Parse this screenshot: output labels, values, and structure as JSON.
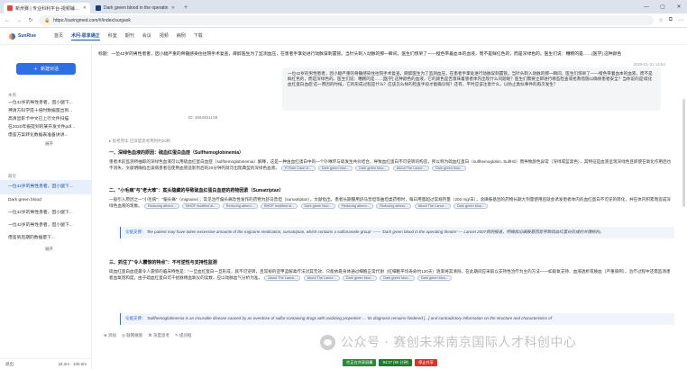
{
  "browser": {
    "tabs": [
      {
        "label": "新卅赛 | 专业科利平台-视频辅导...",
        "fav_color": "#e0443a",
        "active": true
      },
      {
        "label": "Dark green blood in the operatin",
        "fav_color": "#1a3d7c",
        "active": false
      }
    ],
    "url": "https://suringmed.com/#/index/surgask",
    "win_controls": [
      "—",
      "▢",
      "✕"
    ]
  },
  "app": {
    "logo_text": "SunRise",
    "nav": [
      "首页",
      "术问-思享通正",
      "科室",
      "期刊",
      "会议",
      "视频",
      "病例",
      "下载"
    ],
    "nav_active_index": 1
  },
  "sidebar": {
    "new_chat_label": "新建对话",
    "sections": [
      {
        "head": "本周",
        "items": [
          "一位42岁的男性患者，因小腿下...",
          "神清方科学提十倍时数据量出到...",
          "高清显影卡中文已上行文件扫描",
          "在2020年报提到的某开发文件pdf...",
          "借鉴方案转化数据表准备讲讲..."
        ],
        "more": "展开"
      },
      {
        "head": "最近",
        "items": [
          "一位42岁的男性患者，因小腿下...",
          "Dark green blood",
          "一位42岁的男性患者，因小腿下...",
          "一位42岁的男性患者，因小腿下...",
          "借鉴到后期的数据量下..."
        ],
        "more": "展开",
        "selected_index": 0
      }
    ],
    "footer_left": "退出",
    "footer_right": "32.2m · 100.0m"
  },
  "conversation": {
    "prompt": "标题：一位42岁的男性患者，因小腿严重的骨髓感染住往院手术复查，麻醉医生为了监测血压，在患者手掌处进行动脉穿刺置管。当针头刺入动脉的那一瞬间，医生们惊呆了——橙色带着血本的血液，而不是鲜红色的，而是深绿色的。医生们说：糟糕的是……[医学] 这种颜色",
    "timestamp": "2026-01-31 14:54",
    "user_text": "一位42岁的男性患者，因小腿严重的骨髓感染住往院手术复查，麻醉医生为了监测血压，在患者手掌处进行动脉穿刺置管。当针头刺入动脉的那一瞬间，医生们惊呆了——橙色带着血本的血液，而不是鲜红色的，而是深绿色的。医生们说：糟糕的是……[医学] 这种颜色的血液，它的颜色是否意味着患者体内出现什么问题呢？医生们需要立即进行哪些检查或抢救措施以确保患者安全？当你说的是'硫化血红蛋白血症'这一原因的时候，它的形成过程是什么？应该怎么样的检查手段才能确诊呢？还有，平时应该注意什么，以防止类似事件的再次发生？",
    "id_line": "ID: 46634511X8",
    "hint": "▸ 思考完毕 已深度思考用时约20秒",
    "sections": [
      {
        "title": "一、深绿色血液的原因：硫血红蛋白血症（Sulfhemoglobinemia）",
        "body": "患者术前监测所抽取的深绿色血液可以用硫血红蛋白血症（sulfhemoglobinemia）解释，这是一种由血红蛋白中的一个卟啉环与硫发生共价结合，导致血红蛋白不可逆转的构造，所以称为硫血红蛋白（sulfhemoglobin, SulfHb）而导致颜色异常（深绿或蓝黑色），其特征是血液呈现深绿色且即使在氧化作用后也不消失，文献明确指出该病患者在使用血管造影剂后的20分钟内就可出现典型的深绿色血液。",
        "chips": [
          "R Rare Case of...",
          "Dark green bloo...",
          "Dark green bloo...",
          "About The Lance...",
          "Dark green bloo..."
        ]
      },
      {
        "title": "二、\"小毛病\"与\"老大难\"：案头隐藏的导致硫血红蛋白血症的药物因素（Sumatriptan）",
        "body": "一般引入原因之一\"小毛病\"：\"偏头痛\"（migraine）；常见治疗偏头痛急性发作的药物为舒马普坦（sumatriptan）。文献指出，患者长期服用舒马普坦等曲坦类药物时，每日用量超过常规剂量（200 mg/日），含磺胺基团的药物长期大剂量使用后就会诱发患者体内的血红蛋白不可逆的转化，并在体内积累而造成深绿色血液的现象。",
        "chips": [
          "Reducing athero...",
          "BHOF modified st...",
          "Reducing athero...",
          "BHOF modified st...",
          "Dark green bloo...",
          "Reducing athero...",
          "Reducing athero...",
          "About The Lance...",
          "Dark green bloo..."
        ],
        "quote_label": "论据支撑：",
        "quote": "'the patient may have taken excessive amounts of the migraine medication, sumatriptan, which contains a sulfonamide group' —— 'Dark green blood in the operating theatre' — Lancet 2007病例报道，明确指出磺胺基团是导致硫血红蛋白形成的关键结构。"
      },
      {
        "title": "三、抓住了\"令人震惊的特点\"：不可逆性与支持性监测",
        "body": "硫血红蛋白血症最令人震惊的临床特性是：\"一旦血红蛋白一旦形成，就不可逆转，且常规的亚甲蓝解毒疗法对其无效，只能依靠身体通过细胞正常代谢（红细胞平均寿命约120天）逐渐将其清除，在此期间应采取以支持性治疗为主的方法——如吸氧支持、血液透析或换血（严重病例）。治疗过程中还需监测患者血氧饱和度，由于硫血红蛋白可干扰脉搏血氧仪的读数，应以动脉血气分析为准。",
        "chips": [
          "About The Lance...",
          "About The Lance...",
          "Dark green bloo...",
          "Dark green bloo...",
          "Dark green bloo..."
        ],
        "quote_label": "论据支撑：",
        "quote": "'Sulfhemoglobinemia is an incurable disease caused by an overdose of sulfur-containing drugs with oxidizing properties' ... 'its diagnosis remains hindered [...] and contradictory information on the structure and characteristics of"
      }
    ]
  },
  "bottombar": [
    "⊕ 添加",
    "◎ 联网搜索",
    "⌘ 深度思考",
    "✎ 提问框"
  ],
  "footer_tags": [
    {
      "label": "作正在共享屏幕",
      "color": "#2a8a3a"
    },
    {
      "label": "94:37 (90 分钟)",
      "color": "#1f7a2e"
    },
    {
      "label": "停止共享",
      "color": "#d9342b"
    }
  ],
  "watermark": "公众号 · 赛创未来南京国际人才科创中心",
  "colors": {
    "accent": "#2f6fe4",
    "brand": "#1f4fa5",
    "chip_bg": "#eef2f8"
  }
}
